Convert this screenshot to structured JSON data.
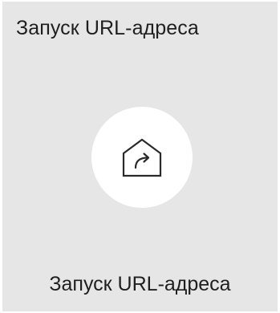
{
  "header": {
    "title": "Запуск URL-адреса"
  },
  "launcher": {
    "icon": "home-share-arrow-icon",
    "label": "Запуск URL-адреса"
  },
  "colors": {
    "panel": "#e6e6e6",
    "tile": "#ffffff",
    "text": "#1f1f1f",
    "icon_stroke": "#2a2a2a"
  }
}
